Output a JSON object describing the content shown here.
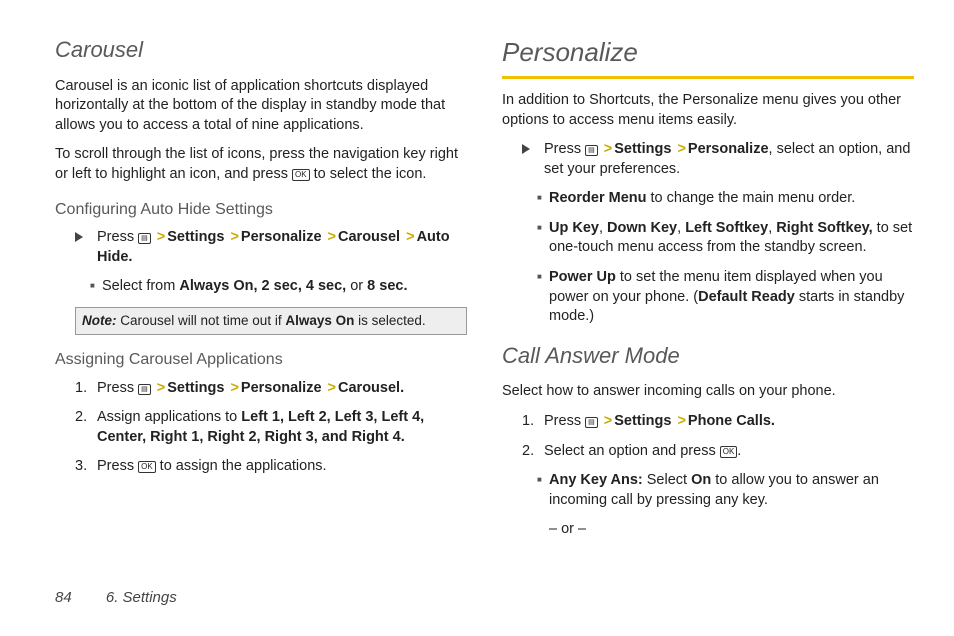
{
  "left": {
    "h_carousel": "Carousel",
    "p1": "Carousel is an iconic list of application shortcuts displayed horizontally at the bottom of the display in standby mode that allows you to access a total of nine applications.",
    "p2a": "To scroll through the list of icons, press the navigation key right or left to highlight an icon, and press ",
    "p2b": " to select the icon.",
    "h_config": "Configuring Auto Hide Settings",
    "cfg_press": "Press ",
    "cfg_path": [
      "Settings",
      "Personalize",
      "Carousel",
      "Auto Hide."
    ],
    "cfg_select_a": "Select from ",
    "cfg_select_b": "Always On, 2 sec, 4 sec,",
    "cfg_select_c": " or ",
    "cfg_select_d": "8 sec.",
    "note_lead": "Note:",
    "note_a": "  Carousel will not time out if ",
    "note_b": "Always On",
    "note_c": " is selected.",
    "h_assign": "Assigning Carousel Applications",
    "a1_press": "Press ",
    "a1_path": [
      "Settings",
      "Personalize",
      "Carousel."
    ],
    "a2_a": "Assign applications to ",
    "a2_b": "Left 1, Left 2, Left 3, Left 4, Center, Right 1, Right 2, Right 3, and Right 4.",
    "a3_a": "Press ",
    "a3_b": " to assign the applications."
  },
  "right": {
    "h_personalize": "Personalize",
    "p1": "In addition to Shortcuts, the Personalize menu gives you other options to access menu items easily.",
    "r1_press": "Press ",
    "r1_path": [
      "Settings",
      "Personalize"
    ],
    "r1_tail": ", select an option, and set your preferences.",
    "b1_a": "Reorder Menu",
    "b1_b": " to change the main menu order.",
    "b2_a": "Up Key",
    "b2_b": "Down Key",
    "b2_c": "Left Softkey",
    "b2_d": "Right  Softkey,",
    "b2_e": " to set one-touch menu access from the standby screen.",
    "b3_a": "Power Up",
    "b3_b": " to set the menu item displayed when you power on your phone. (",
    "b3_c": "Default Ready",
    "b3_d": " starts in standby mode.)",
    "h_call": "Call Answer Mode",
    "cp1": "Select how to answer incoming calls on your phone.",
    "c1_press": "Press ",
    "c1_path": [
      "Settings",
      "Phone Calls."
    ],
    "c2_a": "Select an option and press ",
    "c2_b": ".",
    "cb1_a": "Any Key Ans:",
    "cb1_b": " Select ",
    "cb1_c": "On",
    "cb1_d": " to allow you to answer an incoming call by pressing any key.",
    "or": "– or –"
  },
  "footer": {
    "page": "84",
    "section": "6. Settings"
  },
  "gt": ">",
  "ok": "OK",
  "menu": "▤",
  "sep": ", "
}
